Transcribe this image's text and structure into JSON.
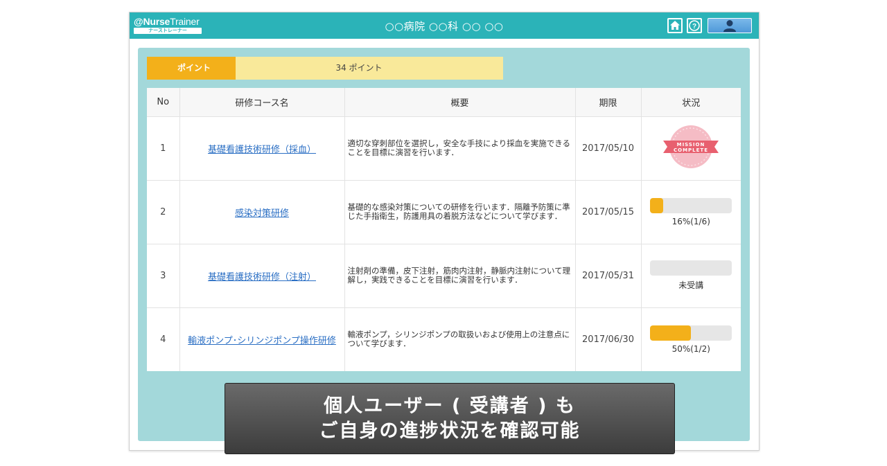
{
  "header": {
    "logo_text_bold": "Nurse",
    "logo_text_thin": "Trainer",
    "logo_subtext": "ナーストレーナー",
    "title": "○○病院 ○○科 ○○ ○○",
    "home_icon": "home-icon",
    "help_icon": "help-icon",
    "user_icon": "user-icon",
    "accent_color": "#2bb3b8"
  },
  "points": {
    "label": "ポイント",
    "value": "34 ポイント"
  },
  "table": {
    "columns": [
      "No",
      "研修コース名",
      "概要",
      "期限",
      "状況"
    ],
    "rows": [
      {
        "no": "1",
        "course": "基礎看護技術研修（採血）",
        "summary": "適切な穿刺部位を選択し，安全な手技により採血を実施できることを目標に演習を行います．",
        "deadline": "2017/05/10",
        "status_type": "complete",
        "badge_line1": "MISSION",
        "badge_line2": "COMPLETE"
      },
      {
        "no": "2",
        "course": "感染対策研修",
        "summary": "基礎的な感染対策についての研修を行います．隔離予防策に準じた手指衛生，防護用具の着脱方法などについて学びます．",
        "deadline": "2017/05/15",
        "status_type": "progress",
        "progress": 0.16,
        "progress_text": "16%(1/6)"
      },
      {
        "no": "3",
        "course": "基礎看護技術研修（注射）",
        "summary": "注射剤の準備，皮下注射，筋肉内注射，静脈内注射について理解し，実践できることを目標に演習を行います．",
        "deadline": "2017/05/31",
        "status_type": "progress",
        "progress": 0,
        "progress_text": "未受講"
      },
      {
        "no": "4",
        "course": "輸液ポンプ･シリンジポンプ操作研修",
        "summary": "輸液ポンプ，シリンジポンプの取扱いおよび使用上の注意点について学びます．",
        "deadline": "2017/06/30",
        "status_type": "progress",
        "progress": 0.5,
        "progress_text": "50%(1/2)"
      }
    ]
  },
  "caption": {
    "line1": "個人ユーザー ( 受講者 ) も",
    "line2": "ご自身の進捗状況を確認可能"
  }
}
